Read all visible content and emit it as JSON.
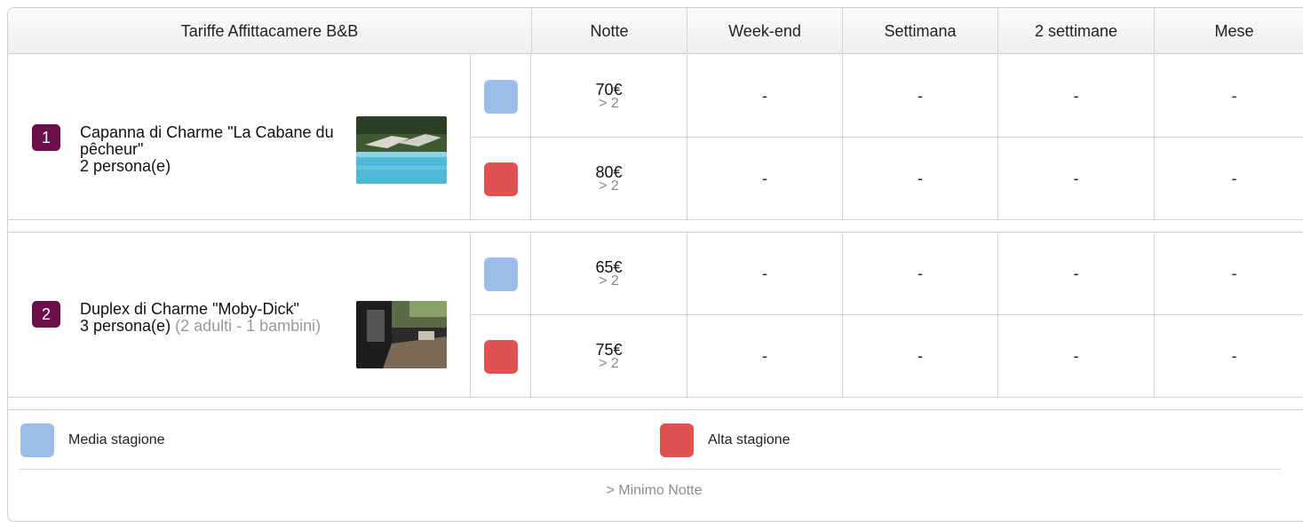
{
  "header": {
    "title": "Tariffe Affittacamere B&B",
    "columns": [
      "Notte",
      "Week-end",
      "Settimana",
      "2 settimane",
      "Mese"
    ]
  },
  "colors": {
    "media": "#9bbde8",
    "alta": "#e05252",
    "badge": "#6b0f4a"
  },
  "rooms": [
    {
      "number": "1",
      "name": "Capanna di Charme \"La Cabane du pêcheur\"",
      "capacity": "2 persona(e)",
      "extra": "",
      "image": "pool-photo",
      "rates": [
        {
          "season": "media",
          "price": "70€",
          "min": "> 2",
          "weekend": "-",
          "week": "-",
          "two_weeks": "-",
          "month": "-"
        },
        {
          "season": "alta",
          "price": "80€",
          "min": "> 2",
          "weekend": "-",
          "week": "-",
          "two_weeks": "-",
          "month": "-"
        }
      ]
    },
    {
      "number": "2",
      "name": "Duplex di Charme \"Moby-Dick\"",
      "capacity": "3 persona(e)",
      "extra": "(2 adulti - 1 bambini)",
      "image": "garden-photo",
      "rates": [
        {
          "season": "media",
          "price": "65€",
          "min": "> 2",
          "weekend": "-",
          "week": "-",
          "two_weeks": "-",
          "month": "-"
        },
        {
          "season": "alta",
          "price": "75€",
          "min": "> 2",
          "weekend": "-",
          "week": "-",
          "two_weeks": "-",
          "month": "-"
        }
      ]
    }
  ],
  "legend": {
    "media_label": "Media stagione",
    "alta_label": "Alta stagione",
    "note": "> Minimo Notte"
  }
}
